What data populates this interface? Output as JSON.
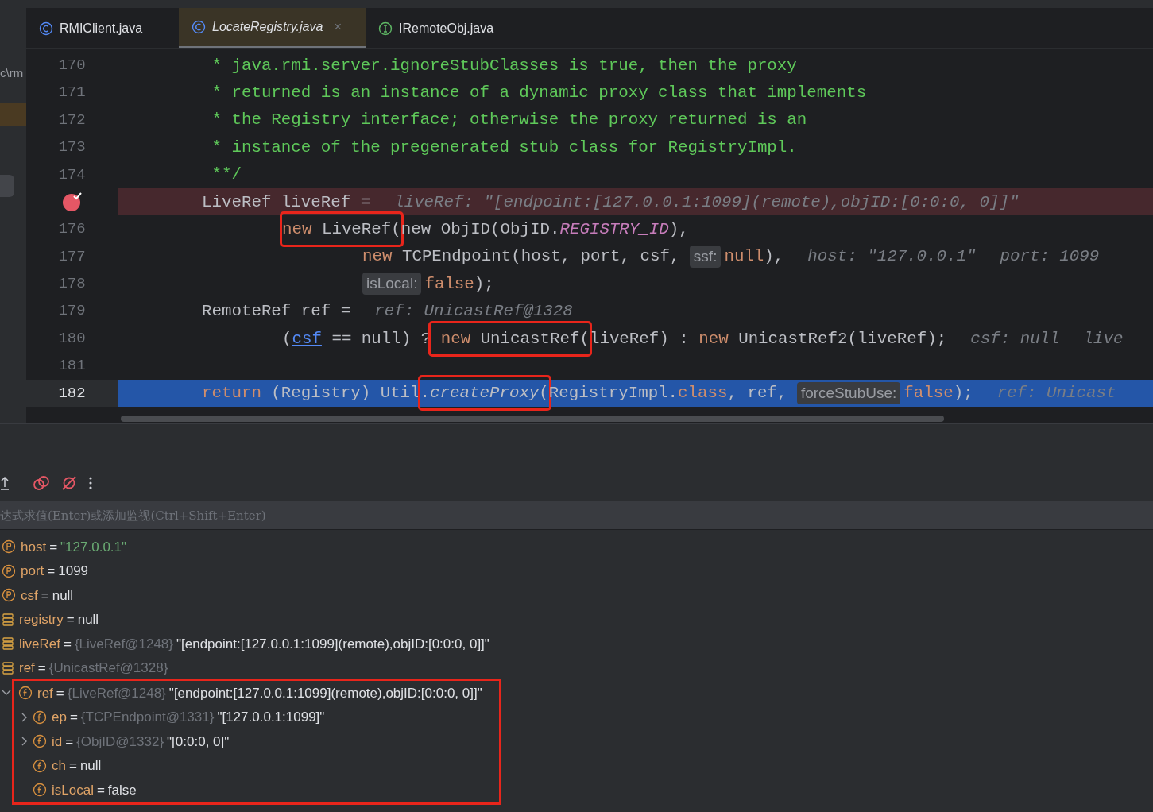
{
  "side_strip": {
    "path": "c\\rm"
  },
  "tabs": [
    {
      "label": "RMIClient.java",
      "kind": "class",
      "selected": false
    },
    {
      "label": "LocateRegistry.java",
      "kind": "class",
      "selected": true,
      "close": "×"
    },
    {
      "label": "IRemoteObj.java",
      "kind": "interface",
      "selected": false
    }
  ],
  "code_lines": [
    {
      "number": "170",
      "kind": "normal",
      "segments": [
        {
          "kind": "comment",
          "text": " * java.rmi.server.ignoreStubClasses is true, then the proxy"
        }
      ]
    },
    {
      "number": "171",
      "kind": "normal",
      "segments": [
        {
          "kind": "comment",
          "text": " * returned is an instance of a dynamic proxy class that implements"
        }
      ]
    },
    {
      "number": "172",
      "kind": "normal",
      "segments": [
        {
          "kind": "comment",
          "text": " * the Registry interface; otherwise the proxy returned is an"
        }
      ]
    },
    {
      "number": "173",
      "kind": "normal",
      "segments": [
        {
          "kind": "comment",
          "text": " * instance of the pregenerated stub class for RegistryImpl."
        }
      ]
    },
    {
      "number": "174",
      "kind": "normal",
      "segments": [
        {
          "kind": "comment",
          "text": " **/"
        }
      ]
    },
    {
      "kind": "breakpoint",
      "segments": [
        {
          "kind": "plain",
          "text": "LiveRef liveRef ="
        },
        {
          "kind": "hint",
          "text": "liveRef: \"[endpoint:[127.0.0.1:1099](remote),objID:[0:0:0, 0]]\""
        }
      ],
      "children": [
        {
          "number": "176",
          "kind": "normal",
          "segments": [
            {
              "kind": "box",
              "segments": [
                {
                  "kind": "keyword",
                  "text": "new"
                },
                {
                  "kind": "plain",
                  "text": " LiveRef("
                }
              ]
            },
            {
              "kind": "plain",
              "text": "new ObjID(ObjID."
            },
            {
              "kind": "static",
              "text": "REGISTRY_ID"
            },
            {
              "kind": "plain",
              "text": "),"
            }
          ],
          "children": [
            {
              "number": "177",
              "kind": "normal",
              "segments": [
                {
                  "kind": "keyword",
                  "text": "new"
                },
                {
                  "kind": "plain",
                  "text": " TCPEndpoint(host, port, csf, "
                },
                {
                  "kind": "inlay",
                  "text": "ssf:"
                },
                {
                  "kind": "keyword",
                  "text": "null"
                },
                {
                  "kind": "plain",
                  "text": "),"
                },
                {
                  "kind": "hint",
                  "text": "host: \"127.0.0.1\""
                },
                {
                  "kind": "hint",
                  "text": "port: 1099"
                }
              ]
            },
            {
              "number": "178",
              "kind": "normal",
              "segments": [
                {
                  "kind": "inlay",
                  "text": "isLocal:"
                },
                {
                  "kind": "keyword",
                  "text": "false"
                },
                {
                  "kind": "plain",
                  "text": ");"
                }
              ]
            }
          ]
        }
      ]
    },
    {
      "number": "179",
      "kind": "normal",
      "segments": [
        {
          "kind": "plain",
          "text": "RemoteRef ref ="
        },
        {
          "kind": "hint",
          "text": "ref: UnicastRef@1328"
        }
      ],
      "children": [
        {
          "number": "180",
          "kind": "normal",
          "segments": [
            {
              "kind": "plain",
              "text": "("
            },
            {
              "kind": "link",
              "text": "csf"
            },
            {
              "kind": "plain",
              "text": " == null) ?"
            },
            {
              "kind": "box",
              "segments": [
                {
                  "kind": "keyword",
                  "text": " new"
                },
                {
                  "kind": "plain",
                  "text": " UnicastRef("
                }
              ]
            },
            {
              "kind": "plain",
              "text": "liveRef) : "
            },
            {
              "kind": "keyword",
              "text": "new"
            },
            {
              "kind": "plain",
              "text": " UnicastRef2(liveRef);"
            },
            {
              "kind": "hint",
              "text": "csf: null"
            },
            {
              "kind": "hint",
              "text": "live"
            }
          ]
        }
      ]
    },
    {
      "number": "181",
      "kind": "normal"
    },
    {
      "number": "182",
      "kind": "current",
      "segments": [
        {
          "kind": "keyword",
          "text": "return"
        },
        {
          "kind": "plain",
          "text": " (Registry) Util"
        },
        {
          "kind": "box",
          "segments": [
            {
              "kind": "plain",
              "text": "."
            },
            {
              "kind": "method",
              "text": "createProxy"
            },
            {
              "kind": "plain",
              "text": "("
            }
          ]
        },
        {
          "kind": "plain",
          "text": "RegistryImpl."
        },
        {
          "kind": "keyword",
          "text": "class"
        },
        {
          "kind": "plain",
          "text": ", ref, "
        },
        {
          "kind": "inlay",
          "text": "forceStubUse:"
        },
        {
          "kind": "keyword",
          "text": "false"
        },
        {
          "kind": "plain",
          "text": ");"
        },
        {
          "kind": "hint",
          "text": "ref: Unicast"
        }
      ]
    }
  ],
  "expression_field": {
    "placeholder": "达式求值(Enter)或添加监视(Ctrl+Shift+Enter)"
  },
  "variables": [
    {
      "kind": "param",
      "name": "host",
      "equals": "=",
      "value": "\"127.0.0.1\"",
      "is_string": true
    },
    {
      "kind": "param",
      "name": "port",
      "equals": "=",
      "value": "1099",
      "is_string": false
    },
    {
      "kind": "param",
      "name": "csf",
      "equals": "=",
      "value": "null",
      "is_string": false
    },
    {
      "kind": "local",
      "name": "registry",
      "equals": "=",
      "value": "null",
      "is_string": false
    },
    {
      "kind": "local",
      "name": "liveRef",
      "equals": "=",
      "type": "{LiveRef@1248}",
      "value": "\"[endpoint:[127.0.0.1:1099](remote),objID:[0:0:0, 0]]\"",
      "is_string": false
    },
    {
      "kind": "local",
      "name": "ref",
      "equals": "=",
      "type": "{UnicastRef@1328}",
      "children": [
        {
          "kind": "field",
          "name": "ref",
          "equals": "=",
          "type": "{LiveRef@1248}",
          "value": "\"[endpoint:[127.0.0.1:1099](remote),objID:[0:0:0, 0]]\"",
          "is_string": false,
          "expanded": true,
          "boxed": true,
          "children": [
            {
              "kind": "field",
              "name": "ep",
              "equals": "=",
              "type": "{TCPEndpoint@1331}",
              "value": "\"[127.0.0.1:1099]\"",
              "is_string": false,
              "expanded": false
            },
            {
              "kind": "field",
              "name": "id",
              "equals": "=",
              "type": "{ObjID@1332}",
              "value": "\"[0:0:0, 0]\"",
              "is_string": false,
              "expanded": false
            },
            {
              "kind": "field",
              "name": "ch",
              "equals": "=",
              "value": "null",
              "is_string": false
            },
            {
              "kind": "field",
              "name": "isLocal",
              "equals": "=",
              "value": "false",
              "is_string": false
            }
          ]
        }
      ]
    }
  ]
}
